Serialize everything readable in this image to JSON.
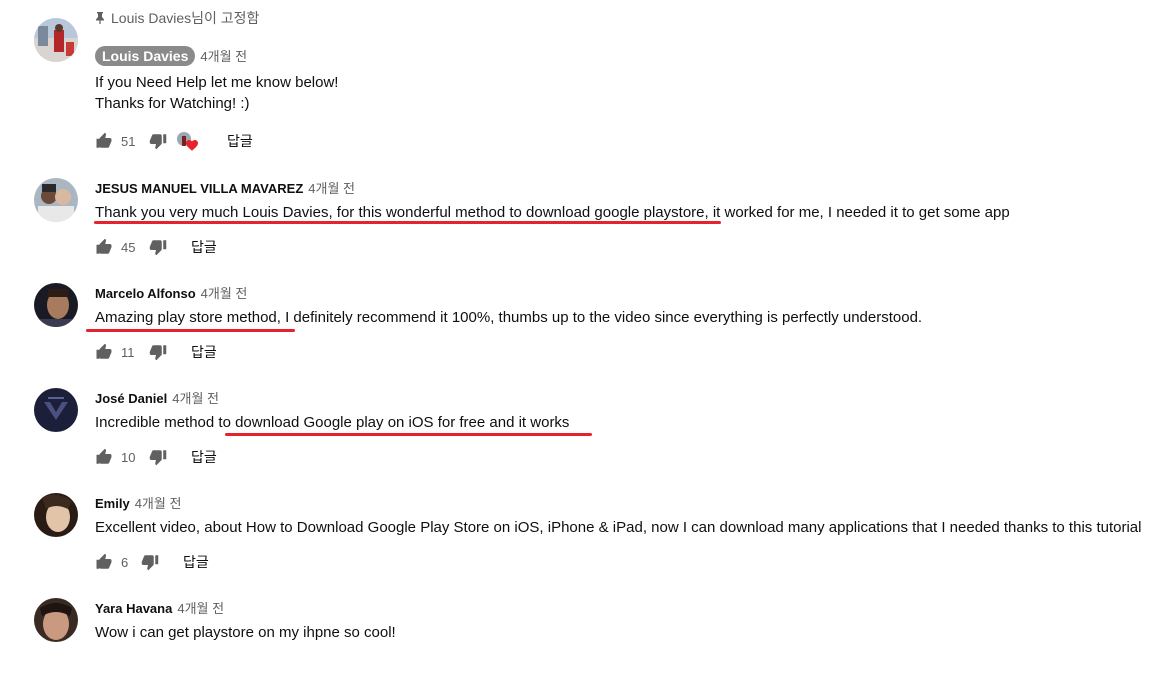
{
  "comments": [
    {
      "pinned_label": "Louis Davies님이 고정함",
      "author": "Louis Davies",
      "time": "4개월 전",
      "lines": [
        "If you Need Help let me know below!",
        "Thanks for Watching! :)"
      ],
      "likes": "51",
      "reply": "답글"
    },
    {
      "author": "JESUS MANUEL VILLA MAVAREZ",
      "time": "4개월 전",
      "text": "Thank you very much Louis Davies, for this wonderful method to download google playstore, it worked for me, I needed it to get some app",
      "likes": "45",
      "reply": "답글"
    },
    {
      "author": "Marcelo Alfonso",
      "time": "4개월 전",
      "text": "Amazing play store method, I definitely recommend it 100%, thumbs up to the video since everything is perfectly understood.",
      "likes": "11",
      "reply": "답글"
    },
    {
      "author": "José Daniel",
      "time": "4개월 전",
      "text": "Incredible method to download Google play on iOS for free and it works",
      "likes": "10",
      "reply": "답글"
    },
    {
      "author": "Emily",
      "time": "4개월 전",
      "text": "Excellent video, about How to Download Google Play Store on iOS, iPhone & iPad, now I can download many applications that I needed thanks to this tutorial",
      "likes": "6",
      "reply": "답글"
    },
    {
      "author": "Yara Havana",
      "time": "4개월 전",
      "text": "Wow i can get playstore on my ihpne so cool!"
    }
  ],
  "colors": {
    "underline": "#e8222a",
    "heart": "#e8222a",
    "badge": "#8a8a8a",
    "secondary_text": "#606060"
  }
}
